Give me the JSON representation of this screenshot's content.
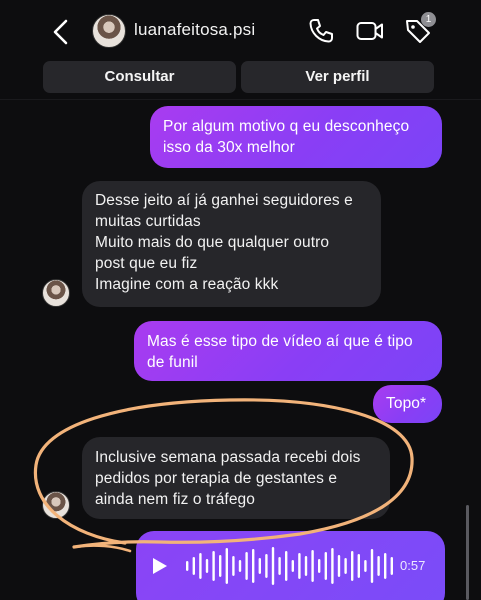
{
  "header": {
    "username": "luanafeitosa.psi",
    "badge_count": "1",
    "icons": [
      "back-chevron-icon",
      "phone-icon",
      "video-camera-icon",
      "tag-icon"
    ]
  },
  "actions": {
    "consultar_label": "Consultar",
    "ver_perfil_label": "Ver perfil"
  },
  "messages": [
    {
      "side": "sent",
      "lines": [
        "Por algum motivo q eu desconheço",
        "isso da 30x melhor"
      ]
    },
    {
      "side": "received",
      "lines": [
        "Desse jeito aí já ganhei seguidores e",
        "muitas curtidas",
        "Muito mais do que qualquer outro",
        "post que eu fiz",
        "Imagine com a reação kkk"
      ]
    },
    {
      "side": "sent",
      "lines": [
        "Mas é esse tipo de vídeo aí que é tipo",
        "de funil"
      ]
    },
    {
      "side": "sent",
      "lines": [
        "Topo*"
      ]
    },
    {
      "side": "received",
      "lines": [
        "Inclusive semana passada recebi dois",
        "pedidos por terapia de gestantes e",
        "ainda nem fiz o tráfego"
      ]
    }
  ],
  "audio_message": {
    "duration": "0:57"
  },
  "colors": {
    "background": "#0d0d0f",
    "sent_bubble": "#8a3ef5",
    "received_bubble": "#26262a",
    "button": "#27272b",
    "annotation": "#f2b37a"
  }
}
